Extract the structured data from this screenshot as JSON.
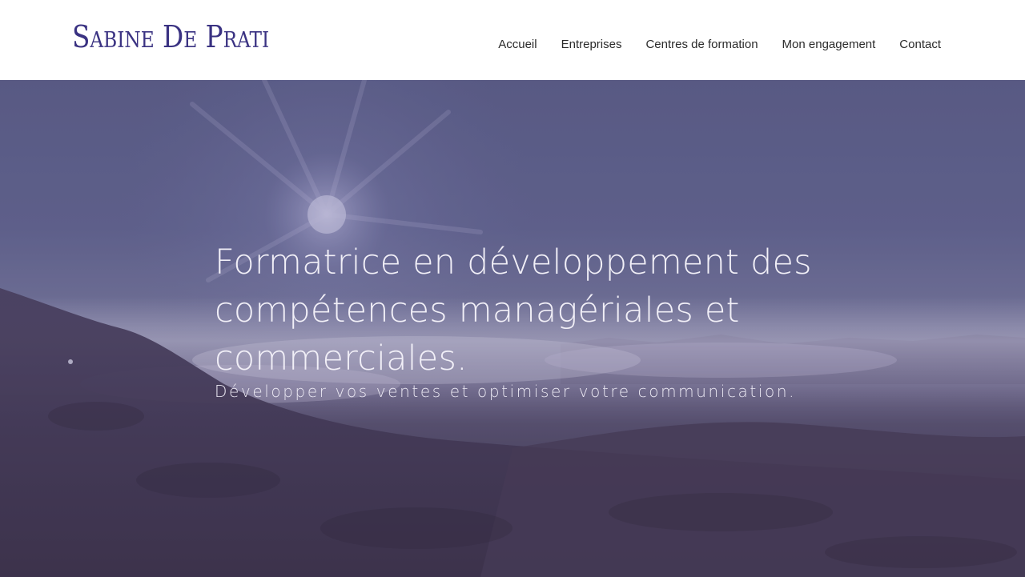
{
  "header": {
    "logo": "Sabine De Prati",
    "nav": [
      {
        "label": "Accueil"
      },
      {
        "label": "Entreprises"
      },
      {
        "label": "Centres de formation"
      },
      {
        "label": "Mon engagement"
      },
      {
        "label": "Contact"
      }
    ]
  },
  "hero": {
    "title_line1": "Formatrice en développement des",
    "title_line2": "compétences managériales et commerciales.",
    "subtitle": "Développer vos ventes et optimiser votre communication."
  },
  "colors": {
    "brand": "#3a3282",
    "nav_text": "#2b2b2b",
    "hero_text": "#f1eff7"
  }
}
